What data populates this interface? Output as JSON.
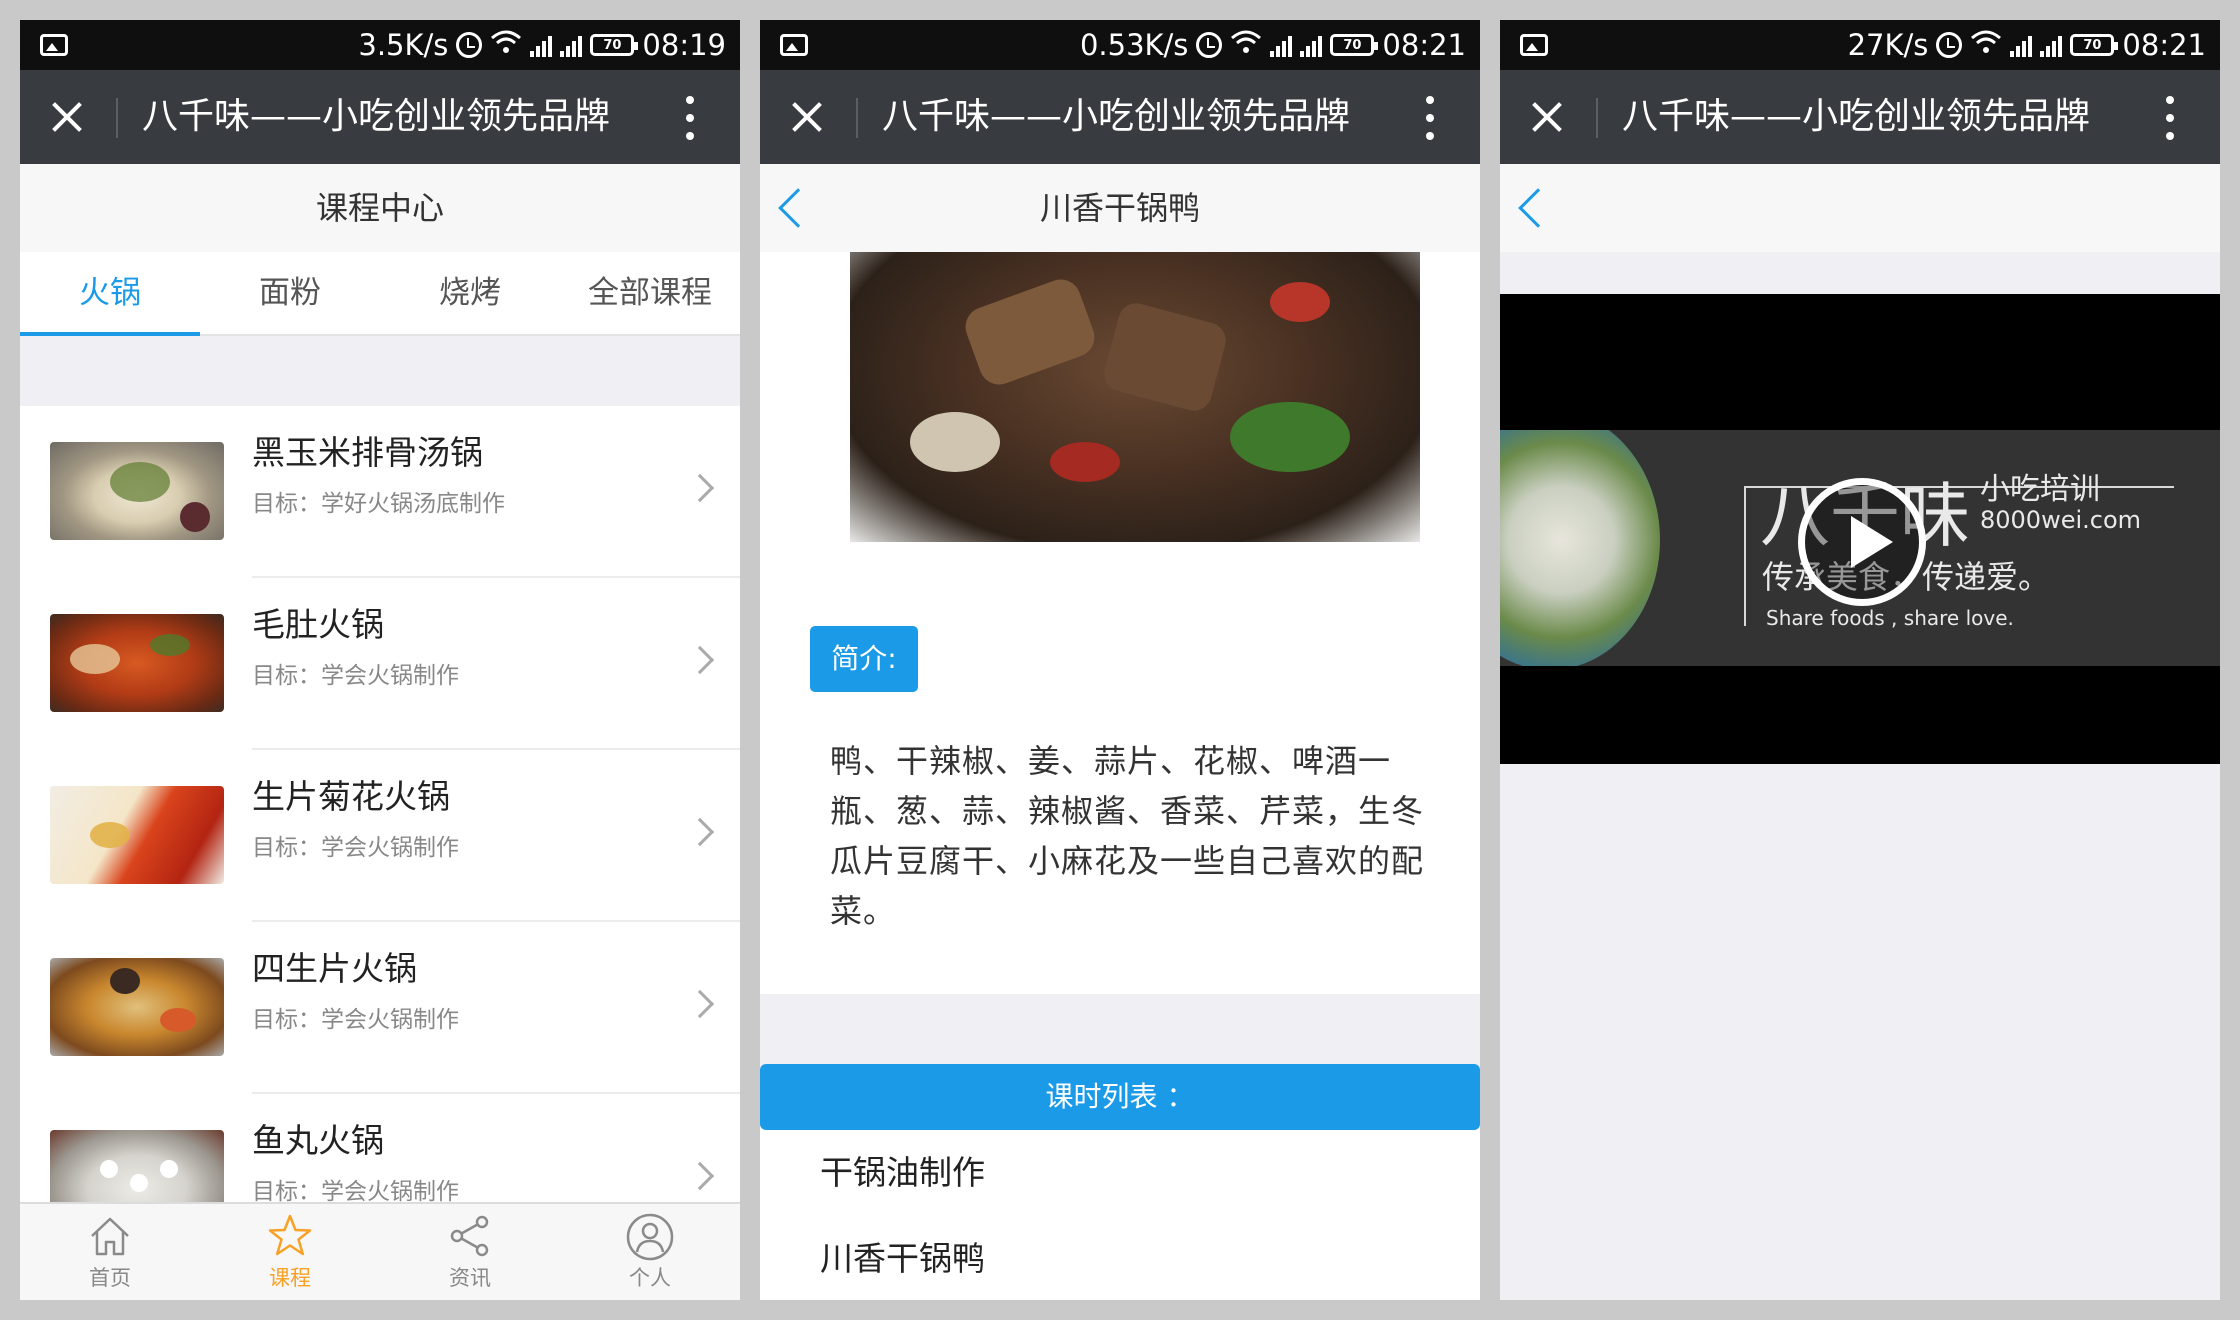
{
  "phone1": {
    "status": {
      "speed": "3.5K/s",
      "time": "08:19",
      "battery": "70"
    },
    "app_title": "八千味——小吃创业领先品牌",
    "page_title": "课程中心",
    "tabs": [
      {
        "label": "火锅"
      },
      {
        "label": "面粉"
      },
      {
        "label": "烧烤"
      },
      {
        "label": "全部课程"
      }
    ],
    "courses": [
      {
        "title": "黑玉米排骨汤锅",
        "subtitle": "目标：学好火锅汤底制作"
      },
      {
        "title": "毛肚火锅",
        "subtitle": "目标：学会火锅制作"
      },
      {
        "title": "生片菊花火锅",
        "subtitle": "目标：学会火锅制作"
      },
      {
        "title": "四生片火锅",
        "subtitle": "目标：学会火锅制作"
      },
      {
        "title": "鱼丸火锅",
        "subtitle": "目标：学会火锅制作"
      }
    ],
    "bottom_nav": [
      {
        "label": "首页",
        "icon": "home-icon"
      },
      {
        "label": "课程",
        "icon": "star-icon"
      },
      {
        "label": "资讯",
        "icon": "share-icon"
      },
      {
        "label": "个人",
        "icon": "person-icon"
      }
    ],
    "colors": {
      "accent": "#1b9ae8",
      "nav_active": "#f7a126"
    }
  },
  "phone2": {
    "status": {
      "speed": "0.53K/s",
      "time": "08:21",
      "battery": "70"
    },
    "app_title": "八千味——小吃创业领先品牌",
    "page_title": "川香干锅鸭",
    "intro_label": "简介:",
    "intro_text": "鸭、干辣椒、姜、蒜片、花椒、啤酒一瓶、葱、蒜、辣椒酱、香菜、芹菜，生冬瓜片豆腐干、小麻花及一些自己喜欢的配菜。",
    "lesson_header": "课时列表 ：",
    "lessons": [
      {
        "title": "干锅油制作"
      },
      {
        "title": "川香干锅鸭"
      }
    ]
  },
  "phone3": {
    "status": {
      "speed": "27K/s",
      "time": "08:21",
      "battery": "70"
    },
    "app_title": "八千味——小吃创业领先品牌",
    "video": {
      "brand": "八千味",
      "tagline_small": "小吃培训",
      "url_text": "8000wei.com",
      "slogan": "传承美食，传递爱。",
      "slogan_en": "Share foods , share love."
    }
  }
}
